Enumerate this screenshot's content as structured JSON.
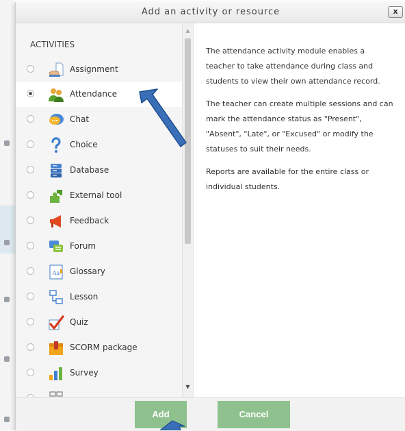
{
  "dialog": {
    "title": "Add an activity or resource",
    "close_label": "x"
  },
  "activities": {
    "header": "ACTIVITIES",
    "items": [
      {
        "label": "Assignment",
        "icon": "assignment-icon",
        "selected": false
      },
      {
        "label": "Attendance",
        "icon": "attendance-icon",
        "selected": true
      },
      {
        "label": "Chat",
        "icon": "chat-icon",
        "selected": false
      },
      {
        "label": "Choice",
        "icon": "choice-icon",
        "selected": false
      },
      {
        "label": "Database",
        "icon": "database-icon",
        "selected": false
      },
      {
        "label": "External tool",
        "icon": "external-tool-icon",
        "selected": false
      },
      {
        "label": "Feedback",
        "icon": "feedback-icon",
        "selected": false
      },
      {
        "label": "Forum",
        "icon": "forum-icon",
        "selected": false
      },
      {
        "label": "Glossary",
        "icon": "glossary-icon",
        "selected": false
      },
      {
        "label": "Lesson",
        "icon": "lesson-icon",
        "selected": false
      },
      {
        "label": "Quiz",
        "icon": "quiz-icon",
        "selected": false
      },
      {
        "label": "SCORM package",
        "icon": "scorm-icon",
        "selected": false
      },
      {
        "label": "Survey",
        "icon": "survey-icon",
        "selected": false
      }
    ]
  },
  "description": {
    "paragraphs": [
      "The attendance activity module enables a teacher to take attendance during class and students to view their own attendance record.",
      "The teacher can create multiple sessions and can mark the attendance status as \"Present\", \"Absent\", \"Late\", or \"Excused\" or modify the statuses to suit their needs.",
      "Reports are available for the entire class or individual students."
    ]
  },
  "footer": {
    "add_label": "Add",
    "cancel_label": "Cancel"
  },
  "colors": {
    "button_green": "#8fc18e",
    "arrow_blue": "#3a6fb7"
  }
}
